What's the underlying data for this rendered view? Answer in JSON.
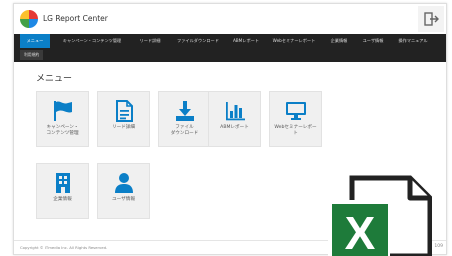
{
  "app": {
    "title": "LG Report Center"
  },
  "nav": {
    "items": [
      {
        "label": "メニュー"
      },
      {
        "label": "キャンペーン・コンテンツ管理"
      },
      {
        "label": "リード詳細"
      },
      {
        "label": "ファイルダウンロード"
      },
      {
        "label": "ABMレポート"
      },
      {
        "label": "Webセミナーレポート"
      },
      {
        "label": "企業情報"
      },
      {
        "label": "ユーザ情報"
      },
      {
        "label": "操作マニュアル"
      }
    ],
    "sub_tab": "利用規約"
  },
  "main": {
    "title": "メニュー",
    "tiles": [
      {
        "label": "キャンペーン・\nコンテンツ管理",
        "icon": "flag-icon"
      },
      {
        "label": "リード詳細",
        "icon": "document-icon"
      },
      {
        "label": "ファイル\nダウンロード",
        "icon": "download-icon"
      },
      {
        "label": "ABMレポート",
        "icon": "bar-chart-icon"
      },
      {
        "label": "Webセミナーレポー\nト",
        "icon": "monitor-icon"
      },
      {
        "label": "企業情報",
        "icon": "building-icon"
      },
      {
        "label": "ユーザ情報",
        "icon": "user-icon"
      }
    ]
  },
  "footer": {
    "copyright": "Copyright © ITmedia Inc. All Rights Reserved.",
    "version": "109"
  },
  "overlay": {
    "icon": "excel-icon",
    "letter": "X"
  },
  "colors": {
    "accent": "#0b7fc7",
    "nav_bg": "#222222",
    "tile_bg": "#f0f0f0",
    "excel_green": "#1e7b3a"
  }
}
